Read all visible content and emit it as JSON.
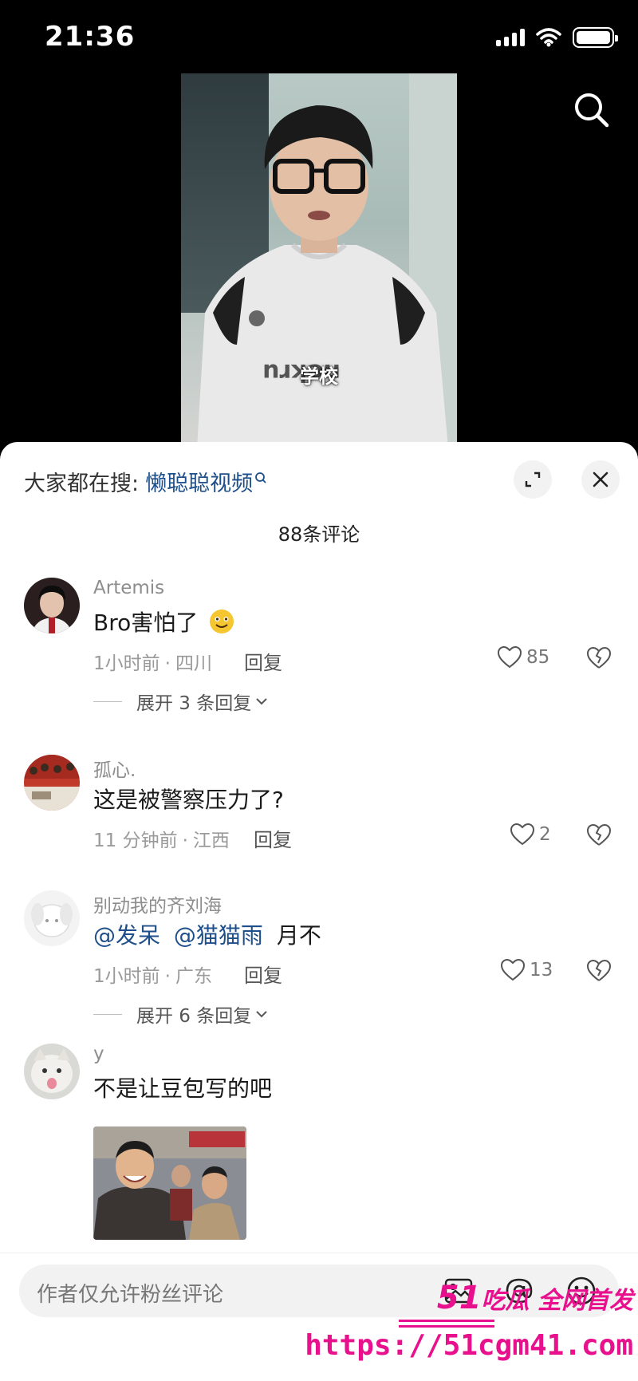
{
  "status_bar": {
    "time": "21:36"
  },
  "video": {
    "subtitle": "学校"
  },
  "sheet": {
    "hot_search_prefix": "大家都在搜:",
    "hot_search_keyword": "懒聪聪视频",
    "comment_count": "88条评论"
  },
  "comments": [
    {
      "user": "Artemis",
      "text": "Bro害怕了",
      "time": "1小时前",
      "location": "四川",
      "reply": "回复",
      "likes": "85",
      "more": "展开 3 条回复"
    },
    {
      "user": "孤心.",
      "text": "这是被警察压力了?",
      "time": "11 分钟前",
      "location": "江西",
      "reply": "回复",
      "likes": "2"
    },
    {
      "user": "别动我的齐刘海",
      "mention1": "@发呆",
      "mention2": "@猫猫雨",
      "text_tail": "月不",
      "time": "1小时前",
      "location": "广东",
      "reply": "回复",
      "likes": "13",
      "more": "展开 6 条回复"
    },
    {
      "user": "y",
      "text": "不是让豆包写的吧"
    }
  ],
  "bottom": {
    "placeholder": "作者仅允许粉丝评论"
  },
  "watermark": {
    "brand_num": "51",
    "brand_text": "吃瓜 全网首发",
    "url": "https://51cgm41.com"
  },
  "colors": {
    "mention": "#1e4f8a",
    "watermark": "#e8108c"
  }
}
